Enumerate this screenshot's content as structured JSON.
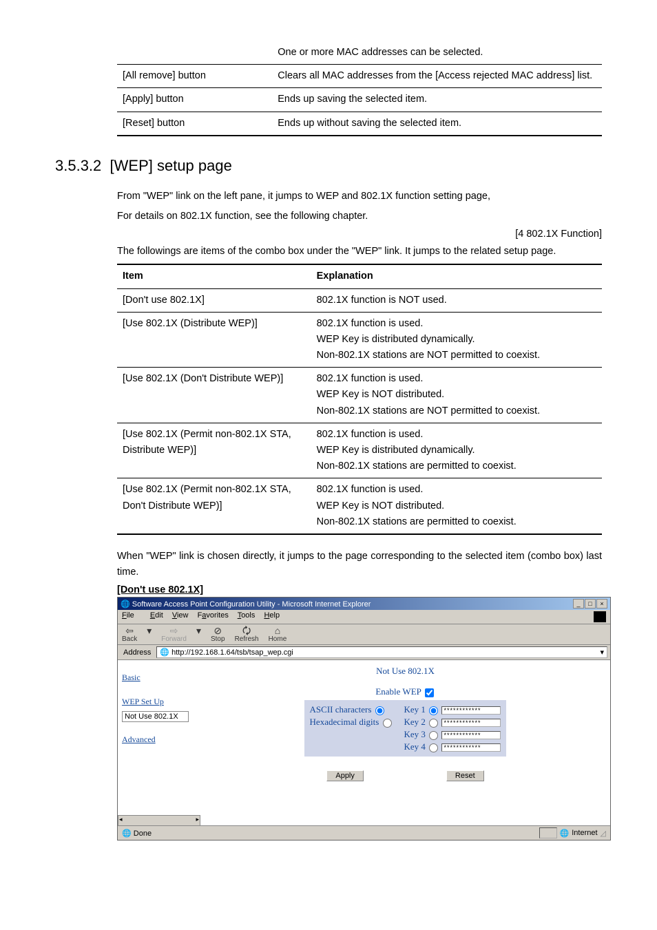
{
  "topTable": {
    "rows": [
      {
        "item": "",
        "exp": "One or more MAC addresses can be selected."
      },
      {
        "item": "[All remove] button",
        "exp": "Clears all MAC addresses from the [Access rejected MAC address] list."
      },
      {
        "item": "[Apply] button",
        "exp": "Ends up saving the selected item."
      },
      {
        "item": "[Reset] button",
        "exp": "Ends up without saving the selected item."
      }
    ]
  },
  "section": {
    "number": "3.5.3.2",
    "title": "[WEP] setup page"
  },
  "para1a": "From \"WEP\" link on the left pane, it jumps to WEP and 802.1X function setting page,",
  "para1b": "For details on 802.1X function, see the following chapter.",
  "ref": "[4 802.1X Function]",
  "para2": "The followings are items of the combo box under the \"WEP\" link. It jumps to the related setup page.",
  "mainTable": {
    "head": {
      "c1": "Item",
      "c2": "Explanation"
    },
    "rows": [
      {
        "item": "[Don't use 802.1X]",
        "exp": "802.1X function is NOT used."
      },
      {
        "item": "[Use 802.1X (Distribute WEP)]",
        "exp": "802.1X function is used.\nWEP Key is distributed dynamically.\nNon-802.1X stations are NOT permitted to coexist."
      },
      {
        "item": "[Use 802.1X (Don't Distribute WEP)]",
        "exp": "802.1X function is used.\nWEP Key is NOT distributed.\nNon-802.1X stations are NOT permitted to coexist."
      },
      {
        "item": "[Use 802.1X (Permit non-802.1X STA, Distribute WEP)]",
        "exp": "802.1X function is used.\nWEP Key is distributed dynamically.\nNon-802.1X stations are permitted to coexist."
      },
      {
        "item": "[Use 802.1X (Permit non-802.1X STA, Don't Distribute WEP)]",
        "exp": "802.1X function is used.\nWEP Key is NOT distributed.\nNon-802.1X stations are permitted to coexist."
      }
    ]
  },
  "para3": "When \"WEP\" link is chosen directly, it jumps to the page corresponding to the selected item (combo box) last time.",
  "subhead": "[Don't use 802.1X]",
  "ie": {
    "title": "Software Access Point Configuration Utility - Microsoft Internet Explorer",
    "menu": {
      "file": "File",
      "edit": "Edit",
      "view": "View",
      "fav": "Favorites",
      "tools": "Tools",
      "help": "Help"
    },
    "toolbar": {
      "back": "Back",
      "forward": "Forward",
      "stop": "Stop",
      "refresh": "Refresh",
      "home": "Home"
    },
    "addressLabel": "Address",
    "url": "http://192.168.1.64/tsb/tsap_wep.cgi",
    "sidebar": {
      "basic": "Basic",
      "wepsetup": "WEP Set Up",
      "combo": "Not Use 802.1X",
      "advanced": "Advanced"
    },
    "main": {
      "heading": "Not Use 802.1X",
      "enableLabel": "Enable WEP",
      "ascii": "ASCII characters",
      "hex": "Hexadecimal digits",
      "key1": "Key 1",
      "key2": "Key 2",
      "key3": "Key 3",
      "key4": "Key 4",
      "mask": "************",
      "apply": "Apply",
      "reset": "Reset"
    },
    "status": {
      "done": "Done",
      "zone": "Internet"
    }
  }
}
